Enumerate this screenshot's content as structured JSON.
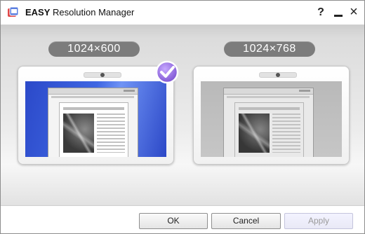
{
  "window": {
    "title_brand": "EASY",
    "title_rest": "Resolution Manager",
    "help_label": "?",
    "close_label": "×"
  },
  "resolutions": [
    {
      "label": "1024×600",
      "selected": true
    },
    {
      "label": "1024×768",
      "selected": false
    }
  ],
  "buttons": {
    "ok": "OK",
    "cancel": "Cancel",
    "apply": "Apply",
    "apply_enabled": false
  },
  "colors": {
    "selected_screen": "#3557d6",
    "check_badge": "#8e6bd8",
    "label_pill": "#7c7c7c"
  },
  "icons": {
    "app": "resolution-manager-app-icon",
    "selected": "checkmark-badge-icon"
  }
}
